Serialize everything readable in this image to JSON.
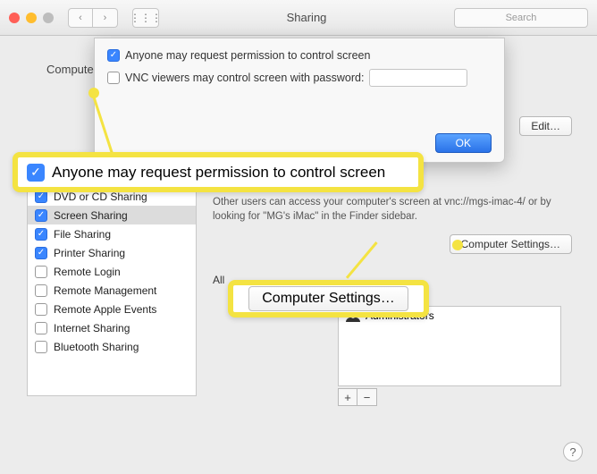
{
  "window": {
    "title": "Sharing",
    "search_placeholder": "Search"
  },
  "computer_name_label": "Compute",
  "edit_button": "Edit…",
  "dialog": {
    "option1": {
      "checked": true,
      "label": "Anyone may request permission to control screen"
    },
    "option2": {
      "checked": false,
      "label": "VNC viewers may control screen with password:"
    },
    "ok": "OK"
  },
  "callout_option_label": "Anyone may request permission to control screen",
  "services": [
    {
      "label": "DVD or CD Sharing",
      "on": true,
      "selected": false
    },
    {
      "label": "Screen Sharing",
      "on": true,
      "selected": true
    },
    {
      "label": "File Sharing",
      "on": true,
      "selected": false
    },
    {
      "label": "Printer Sharing",
      "on": true,
      "selected": false
    },
    {
      "label": "Remote Login",
      "on": false,
      "selected": false
    },
    {
      "label": "Remote Management",
      "on": false,
      "selected": false
    },
    {
      "label": "Remote Apple Events",
      "on": false,
      "selected": false
    },
    {
      "label": "Internet Sharing",
      "on": false,
      "selected": false
    },
    {
      "label": "Bluetooth Sharing",
      "on": false,
      "selected": false
    }
  ],
  "info_text": "Other users can access your computer's screen at vnc://mgs-imac-4/ or by looking for \"MG's iMac\" in the Finder sidebar.",
  "computer_settings_button": "Computer Settings…",
  "callout_cs_button": "Computer Settings…",
  "allow_label": "All",
  "users": [
    "Administrators"
  ],
  "plus": "+",
  "minus": "−",
  "help": "?"
}
